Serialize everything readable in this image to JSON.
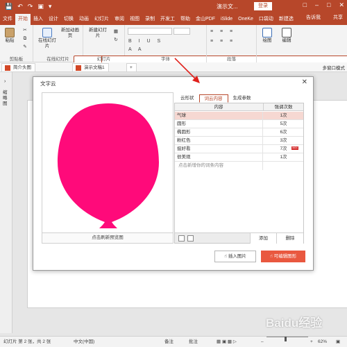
{
  "titlebar": {
    "doc_title": "演示文...",
    "login_label": "登录",
    "quick_access": [
      "save-icon",
      "undo-icon",
      "redo-icon",
      "present-icon",
      "more-icon"
    ]
  },
  "ribbon_tabs": [
    "文件",
    "开始",
    "插入",
    "设计",
    "切换",
    "动画",
    "幻灯片",
    "审阅",
    "视图",
    "录制",
    "开发工",
    "帮助",
    "金山PDF",
    "iSlide",
    "OneKe",
    "口袋动",
    "新建选",
    "告诉我",
    "共享"
  ],
  "ribbon": {
    "groups": [
      {
        "label": "剪贴板",
        "buttons": [
          "粘贴"
        ]
      },
      {
        "label": "在线幻灯片",
        "buttons": [
          "在线幻灯片",
          "新加动画页"
        ]
      },
      {
        "label": "幻灯片",
        "buttons": [
          "新建幻灯片"
        ]
      },
      {
        "label": "字体",
        "buttons": []
      },
      {
        "label": "段落",
        "buttons": []
      },
      {
        "label": "",
        "buttons": [
          "绘图",
          "编辑"
        ]
      }
    ]
  },
  "doc_tabs": [
    "简介头图",
    "演示文稿1"
  ],
  "doc_strip_right": "多窗口模式",
  "left_pane_label": "缩略图",
  "dialog": {
    "title": "文字云",
    "subtabs": [
      "云形状",
      "词云内容",
      "生成参数"
    ],
    "active_subtab": "词云内容",
    "preview_button": "点击刷新预览图",
    "table": {
      "headers": [
        "内容",
        "强调次数"
      ],
      "rows": [
        {
          "word": "气球",
          "count": "1次"
        },
        {
          "word": "圆形",
          "count": "5次"
        },
        {
          "word": "椭圆形",
          "count": "6次"
        },
        {
          "word": "粉红色",
          "count": "3次"
        },
        {
          "word": "挺好看",
          "count": "7次"
        },
        {
          "word": "很美观",
          "count": "1次"
        }
      ],
      "placeholder": "点击新增你的词条内容",
      "max_badge": "MAX",
      "add_label": "添加",
      "delete_label": "删除"
    },
    "insert_image_label": "插入图片",
    "edit_chart_label": "可编辑图形",
    "balloon_color": "#ff0a7a"
  },
  "statusbar": {
    "slide_info": "幻灯片 第 2 张，共 2 张",
    "language": "中文(中国)",
    "notes": "备注",
    "comments": "批注",
    "zoom": "62%"
  },
  "watermark": "Baidu经验",
  "colors": {
    "accent": "#b7472a",
    "dialog_primary": "#e9583f"
  }
}
